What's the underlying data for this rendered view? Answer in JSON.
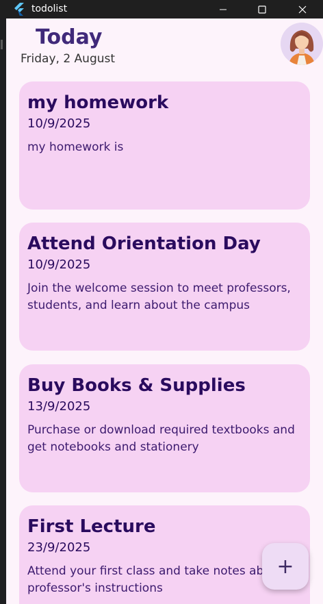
{
  "window": {
    "title": "todolist"
  },
  "header": {
    "title": "Today",
    "date": "Friday, 2 August"
  },
  "tasks": [
    {
      "title": "my homework",
      "date": "10/9/2025",
      "description": "my homework is"
    },
    {
      "title": "Attend Orientation Day",
      "date": "10/9/2025",
      "description": "Join the welcome session to meet professors, students, and learn about the campus"
    },
    {
      "title": "Buy Books & Supplies",
      "date": "13/9/2025",
      "description": "Purchase or download required textbooks and get notebooks and stationery"
    },
    {
      "title": "First Lecture",
      "date": "23/9/2025",
      "description": "Attend your first class and take notes about professor's instructions"
    }
  ],
  "fab": {
    "icon": "plus-icon",
    "label": "+"
  },
  "colors": {
    "background": "#fdf3fb",
    "card": "#f6d2f3",
    "title_text": "#2a0b5e",
    "header_title": "#40297a",
    "titlebar": "#1f1f1f"
  }
}
